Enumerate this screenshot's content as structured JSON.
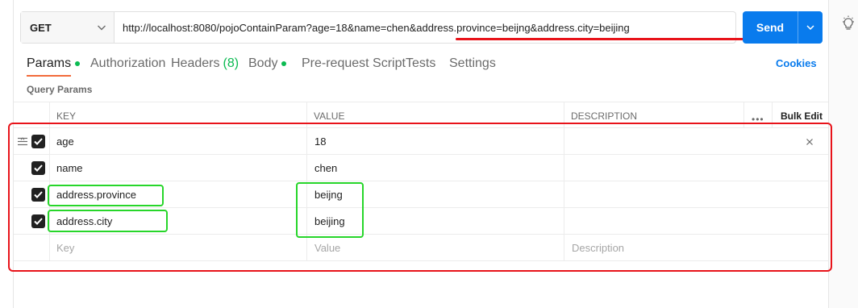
{
  "request": {
    "method": "GET",
    "url": "http://localhost:8080/pojoContainParam?age=18&name=chen&address.province=beijng&address.city=beijing",
    "send_label": "Send"
  },
  "tabs": [
    {
      "label": "Params",
      "indicator": "dot"
    },
    {
      "label": "Authorization"
    },
    {
      "label": "Headers",
      "count": "(8)"
    },
    {
      "label": "Body",
      "indicator": "dot"
    },
    {
      "label": "Pre-request Script"
    },
    {
      "label": "Tests"
    },
    {
      "label": "Settings"
    }
  ],
  "cookies_label": "Cookies",
  "section_label": "Query Params",
  "table": {
    "headers": {
      "key": "KEY",
      "value": "VALUE",
      "description": "DESCRIPTION",
      "bulk_edit": "Bulk Edit",
      "more": "•••"
    },
    "rows": [
      {
        "key": "age",
        "value": "18",
        "description": "",
        "checked": true
      },
      {
        "key": "name",
        "value": "chen",
        "description": "",
        "checked": true
      },
      {
        "key": "address.province",
        "value": "beijng",
        "description": "",
        "checked": true
      },
      {
        "key": "address.city",
        "value": "beijing",
        "description": "",
        "checked": true
      }
    ],
    "placeholders": {
      "key": "Key",
      "value": "Value",
      "description": "Description"
    }
  },
  "colors": {
    "send_button": "#097bed",
    "active_tab_underline": "#f26b3a",
    "status_dot": "#0cbb52",
    "annotation_red": "#e8131a",
    "annotation_green": "#27d62a"
  },
  "icons": [
    "chevron-down-icon",
    "drag-handle-icon",
    "checkbox-checked-icon",
    "close-icon",
    "more-icon",
    "lightbulb-icon"
  ]
}
